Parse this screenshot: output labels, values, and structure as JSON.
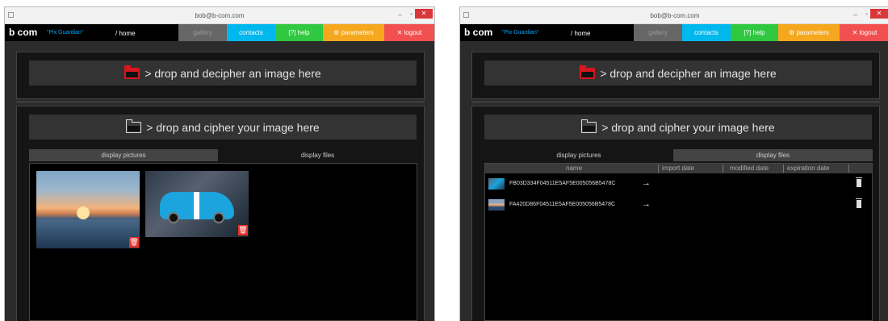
{
  "window": {
    "title": "bob@b-com.com",
    "minimize": "–",
    "maximize": "▫",
    "close": "✕"
  },
  "nav": {
    "brand": "b com",
    "tagline": "\"Pix Guardian\"",
    "home": "/ home",
    "gallery": "gallery",
    "contacts": "contacts",
    "help": "[?] help",
    "parameters": "⚙ parameters",
    "logout": "✕ logout"
  },
  "drop_decipher": "> drop and decipher an image here",
  "drop_cipher": "> drop and cipher your image here",
  "view_tabs": {
    "pictures": "display pictures",
    "files": "display files"
  },
  "file_table": {
    "columns": [
      "name",
      "import date",
      "modified date",
      "expiration date"
    ],
    "rows": [
      {
        "name": "FB03D334F04511E5AF5E005056B5478C",
        "icon": "car-thumbnail-icon"
      },
      {
        "name": "FA420D86F04511E5AF5E005056B5478C",
        "icon": "sunset-thumbnail-icon"
      }
    ]
  },
  "gallery": {
    "images": [
      "sunset-harbor-image",
      "blue-mustang-image"
    ],
    "delete_icon": "trash-icon"
  },
  "colors": {
    "gallery_tab": "#666666",
    "contacts_tab": "#00b7ee",
    "help_tab": "#2fc840",
    "parameters_tab": "#f5a81d",
    "logout_tab": "#f25050",
    "delete_button": "#e8322a",
    "folder_red": "#d8161e"
  }
}
